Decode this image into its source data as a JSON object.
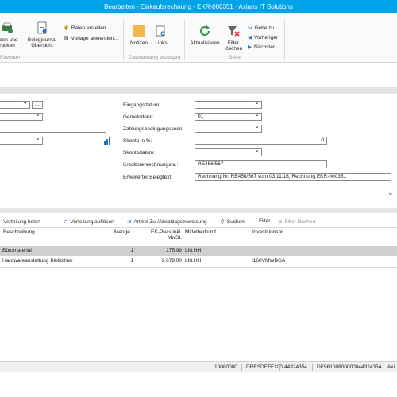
{
  "window": {
    "title": "Bearbeiten - Einkaufsrechnung - EKR-000351 · Axians IT Solutions"
  },
  "ribbon": {
    "buchen": "eben und\nrucken",
    "belegjournal": "Belegjournal\nÜbersicht",
    "raten": "Raten erstellen",
    "vorlage": "Vorlage anwenden...",
    "group_favoriten": "Favoriten",
    "notizen": "Notizen",
    "links": "Links",
    "group_dateianhang": "Dateianhang anzeigen",
    "aktualisieren": "Aktualisieren",
    "filter_loeschen": "Filter\nlöschen",
    "gehe_zu": "Gehe zu",
    "vorheriger": "Vorheriger",
    "naechster": "Nächster",
    "group_seite": "Seite"
  },
  "form": {
    "ellipsis": "...",
    "labels": {
      "eingangsdatum": "Eingangsdatum:",
      "gemeindenr": "Gemeindenr.:",
      "zahlungsbedingung": "Zahlungsbedingungscode:",
      "skonto": "Skonto in %:",
      "skontodatum": "Skontodatum:",
      "kreditorenrechnungsnr": "Kreditorenrechnungsnr.:",
      "erweiterter_belegtext": "Erweiterter Belegtext:"
    },
    "values": {
      "eingangsdatum": "",
      "gemeindenr": "01",
      "zahlungsbedingung": "",
      "skonto": "0",
      "skontodatum": "",
      "kreditorenrechnungsnr": "RE456/567",
      "erweiterter_belegtext": "Rechnung Nr. RE456/567 vom 03.11.16, Rechnung EKR-000351"
    }
  },
  "lines_toolbar": {
    "verteilung_holen": "Verteilung holen",
    "verteilung_aufloesen": "Verteilung auflösen",
    "artikel_zuschlag": "Artikel Zu-/Abschlagszuweisung",
    "suchen": "Suchen",
    "filter": "Filter",
    "filter_loeschen": "Filter löschen"
  },
  "table": {
    "headers": {
      "beschreibung": "Beschreibung",
      "menge": "Menge",
      "ek_preis": "EK-Preis inkl.\nMwSt.",
      "mittelherkunft": "Mittelherkunft",
      "investitionsnr": "Investitionsnr."
    },
    "rows": [
      {
        "beschreibung": "Büromaterial",
        "menge": "1",
        "ek_preis": "175,99",
        "mittelherkunft": "Lfd.HH",
        "investitionsnr": ""
      },
      {
        "beschreibung": "Hardwareaustattung Bibliothek",
        "menge": "1",
        "ek_preis": "2.679,00",
        "mittelherkunft": "Lfd.HH",
        "investitionsnr": "I160VMWBGA"
      }
    ]
  },
  "statusbar": {
    "f1": "10080000",
    "f2": "DRESDEFF100",
    "f3": "44324354",
    "f4": "DE96100800000044324354",
    "f5": "Axi"
  },
  "colors": {
    "titlebar": "#00a2e8",
    "accent_blue": "#1e73be",
    "selected_row": "#cfcfcf"
  }
}
